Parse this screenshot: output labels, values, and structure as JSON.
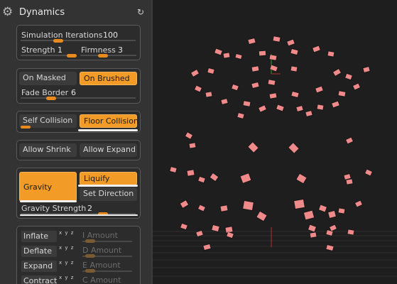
{
  "header": {
    "title": "Dynamics",
    "gear_icon": "gear-icon",
    "reset_icon": "reset-icon"
  },
  "sim": {
    "iterations_label": "Simulation Iterations",
    "iterations_value": "100",
    "iterations_level": 0.3,
    "strength_label": "Strength",
    "strength_value": "1",
    "strength_level": 0.85,
    "firmness_label": "Firmness",
    "firmness_value": "3",
    "firmness_level": 0.15
  },
  "masking": {
    "on_masked": "On Masked",
    "on_brushed": "On Brushed",
    "fade_label": "Fade Border",
    "fade_value": "6",
    "fade_level": 0.28
  },
  "collision": {
    "self": "Self Collision",
    "floor": "Floor Collision"
  },
  "shrink": {
    "allow_shrink": "Allow Shrink",
    "allow_expand": "Allow Expand"
  },
  "gravity": {
    "gravity": "Gravity",
    "liquify": "Liquify",
    "set_direction": "Set Direction",
    "strength_label": "Gravity Strength",
    "strength_value": "2",
    "strength_level": 0.68
  },
  "forces": {
    "xyz": "x y z",
    "rows": [
      {
        "name": "Inflate",
        "amount": "I Amount"
      },
      {
        "name": "Deflate",
        "amount": "D Amount"
      },
      {
        "name": "Expand",
        "amount": "E Amount"
      },
      {
        "name": "Contract",
        "amount": "C Amount"
      }
    ]
  },
  "colors": {
    "accent": "#f29b27",
    "piece": "#f08a8a",
    "viewport_bg": "#1e1e1e"
  }
}
